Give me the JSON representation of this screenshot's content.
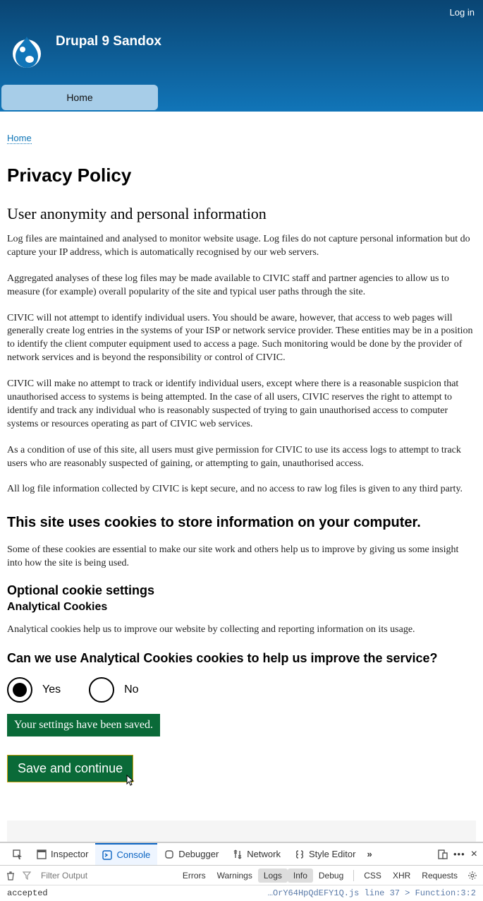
{
  "header": {
    "login": "Log in",
    "site_name": "Drupal 9 Sandox",
    "nav_home": "Home"
  },
  "breadcrumb": {
    "home": "Home"
  },
  "page": {
    "title": "Privacy Policy",
    "h2_anon": "User anonymity and personal information",
    "p1": "Log files are maintained and analysed to monitor website usage. Log files do not capture personal information but do capture your IP address, which is automatically recognised by our web servers.",
    "p2": "Aggregated analyses of these log files may be made available to CIVIC staff and partner agencies to allow us to measure (for example) overall popularity of the site and typical user paths through the site.",
    "p3": "CIVIC will not attempt to identify individual users. You should be aware, however, that access to web pages will generally create log entries in the systems of your ISP or network service provider. These entities may be in a position to identify the client computer equipment used to access a page. Such monitoring would be done by the provider of network services and is beyond the responsibility or control of CIVIC.",
    "p4": "CIVIC will make no attempt to track or identify individual users, except where there is a reasonable suspicion that unauthorised access to systems is being attempted. In the case of all users, CIVIC reserves the right to attempt to identify and track any individual who is reasonably suspected of trying to gain unauthorised access to computer systems or resources operating as part of CIVIC web services.",
    "p5": "As a condition of use of this site, all users must give permission for CIVIC to use its access logs to attempt to track users who are reasonably suspected of gaining, or attempting to gain, unauthorised access.",
    "p6": "All log file information collected by CIVIC is kept secure, and no access to raw log files is given to any third party.",
    "h2_cookies": "This site uses cookies to store information on your computer.",
    "p_cookies": "Some of these cookies are essential to make our site work and others help us to improve by giving us some insight into how the site is being used.",
    "h3_optional": "Optional cookie settings",
    "h4_analytical": "Analytical Cookies",
    "p_analytical": "Analytical cookies help us to improve our website by collecting and reporting information on its usage.",
    "question": "Can we use Analytical Cookies cookies to help us improve the service?",
    "opt_yes": "Yes",
    "opt_no": "No",
    "success": "Your settings have been saved.",
    "save_btn": "Save and continue"
  },
  "devtools": {
    "tabs": {
      "inspector": "Inspector",
      "console": "Console",
      "debugger": "Debugger",
      "network": "Network",
      "style": "Style Editor"
    },
    "filter_placeholder": "Filter Output",
    "pills": {
      "errors": "Errors",
      "warnings": "Warnings",
      "logs": "Logs",
      "info": "Info",
      "debug": "Debug",
      "css": "CSS",
      "xhr": "XHR",
      "requests": "Requests"
    },
    "log": {
      "left": "accepted",
      "right": "…OrY64HpQdEFY1Q.js line 37 > Function:3:2"
    }
  }
}
